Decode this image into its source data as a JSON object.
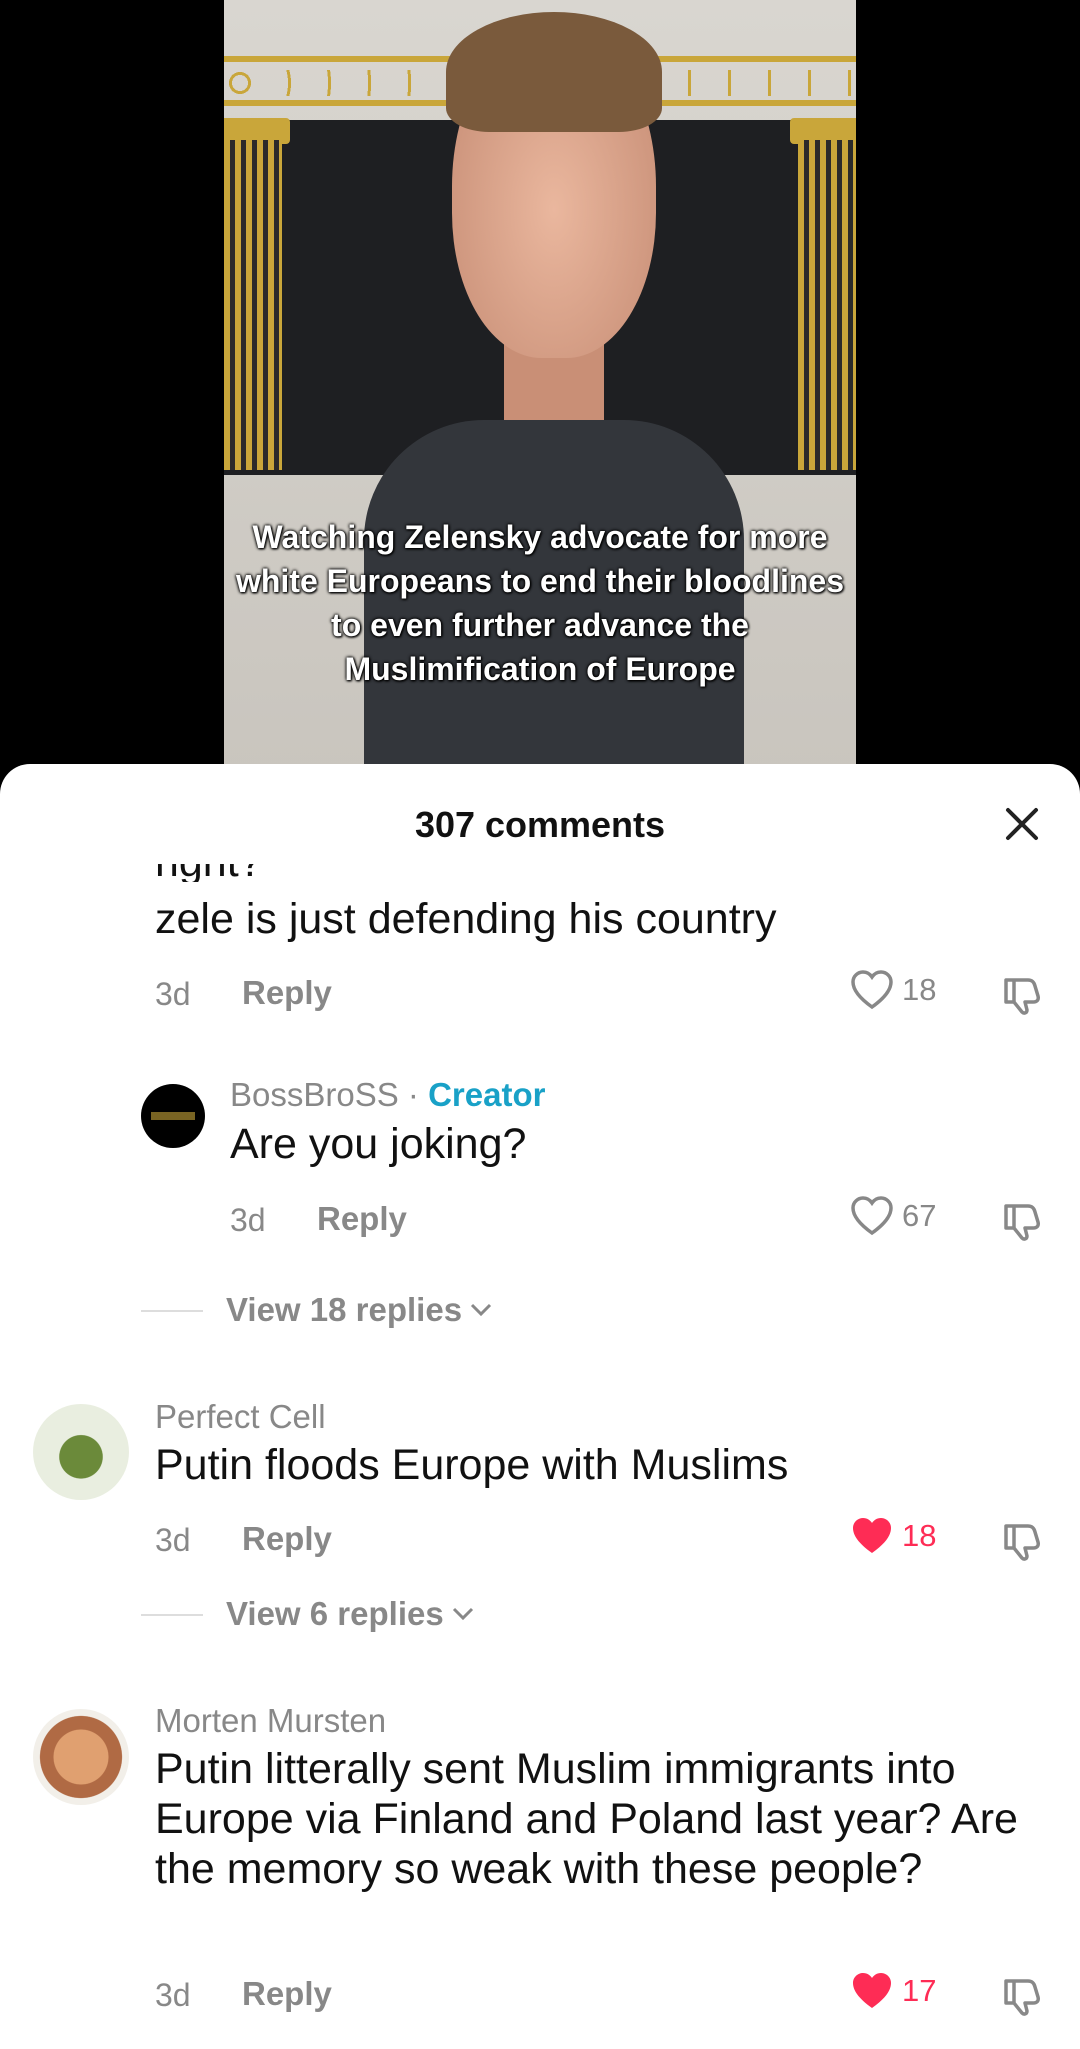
{
  "video": {
    "caption": "Watching Zelensky advocate for more white Europeans to end their bloodlines to even further advance the Muslimification of Europe"
  },
  "comments_panel": {
    "title": "307 comments",
    "partial_comment": {
      "text": "zele is just defending his country",
      "time": "3d",
      "reply_label": "Reply",
      "likes": "18"
    },
    "creator_reply": {
      "author": "BossBroSS",
      "badge_sep": "·",
      "badge": "Creator",
      "text": "Are you joking?",
      "time": "3d",
      "reply_label": "Reply",
      "likes": "67",
      "view_replies": "View 18 replies"
    },
    "comment_2": {
      "author": "Perfect Cell",
      "text": "Putin floods Europe with Muslims",
      "time": "3d",
      "reply_label": "Reply",
      "likes": "18",
      "liked": true,
      "view_replies": "View 6 replies"
    },
    "comment_3": {
      "author": "Morten Mursten",
      "text": "Putin litterally sent Muslim immigrants into Europe via Finland and Poland last year? Are the memory so weak with these people?",
      "time": "3d",
      "reply_label": "Reply",
      "likes": "17",
      "liked": true
    }
  },
  "colors": {
    "liked": "#fe2c55",
    "creator": "#19a1c7",
    "muted": "#888888"
  }
}
